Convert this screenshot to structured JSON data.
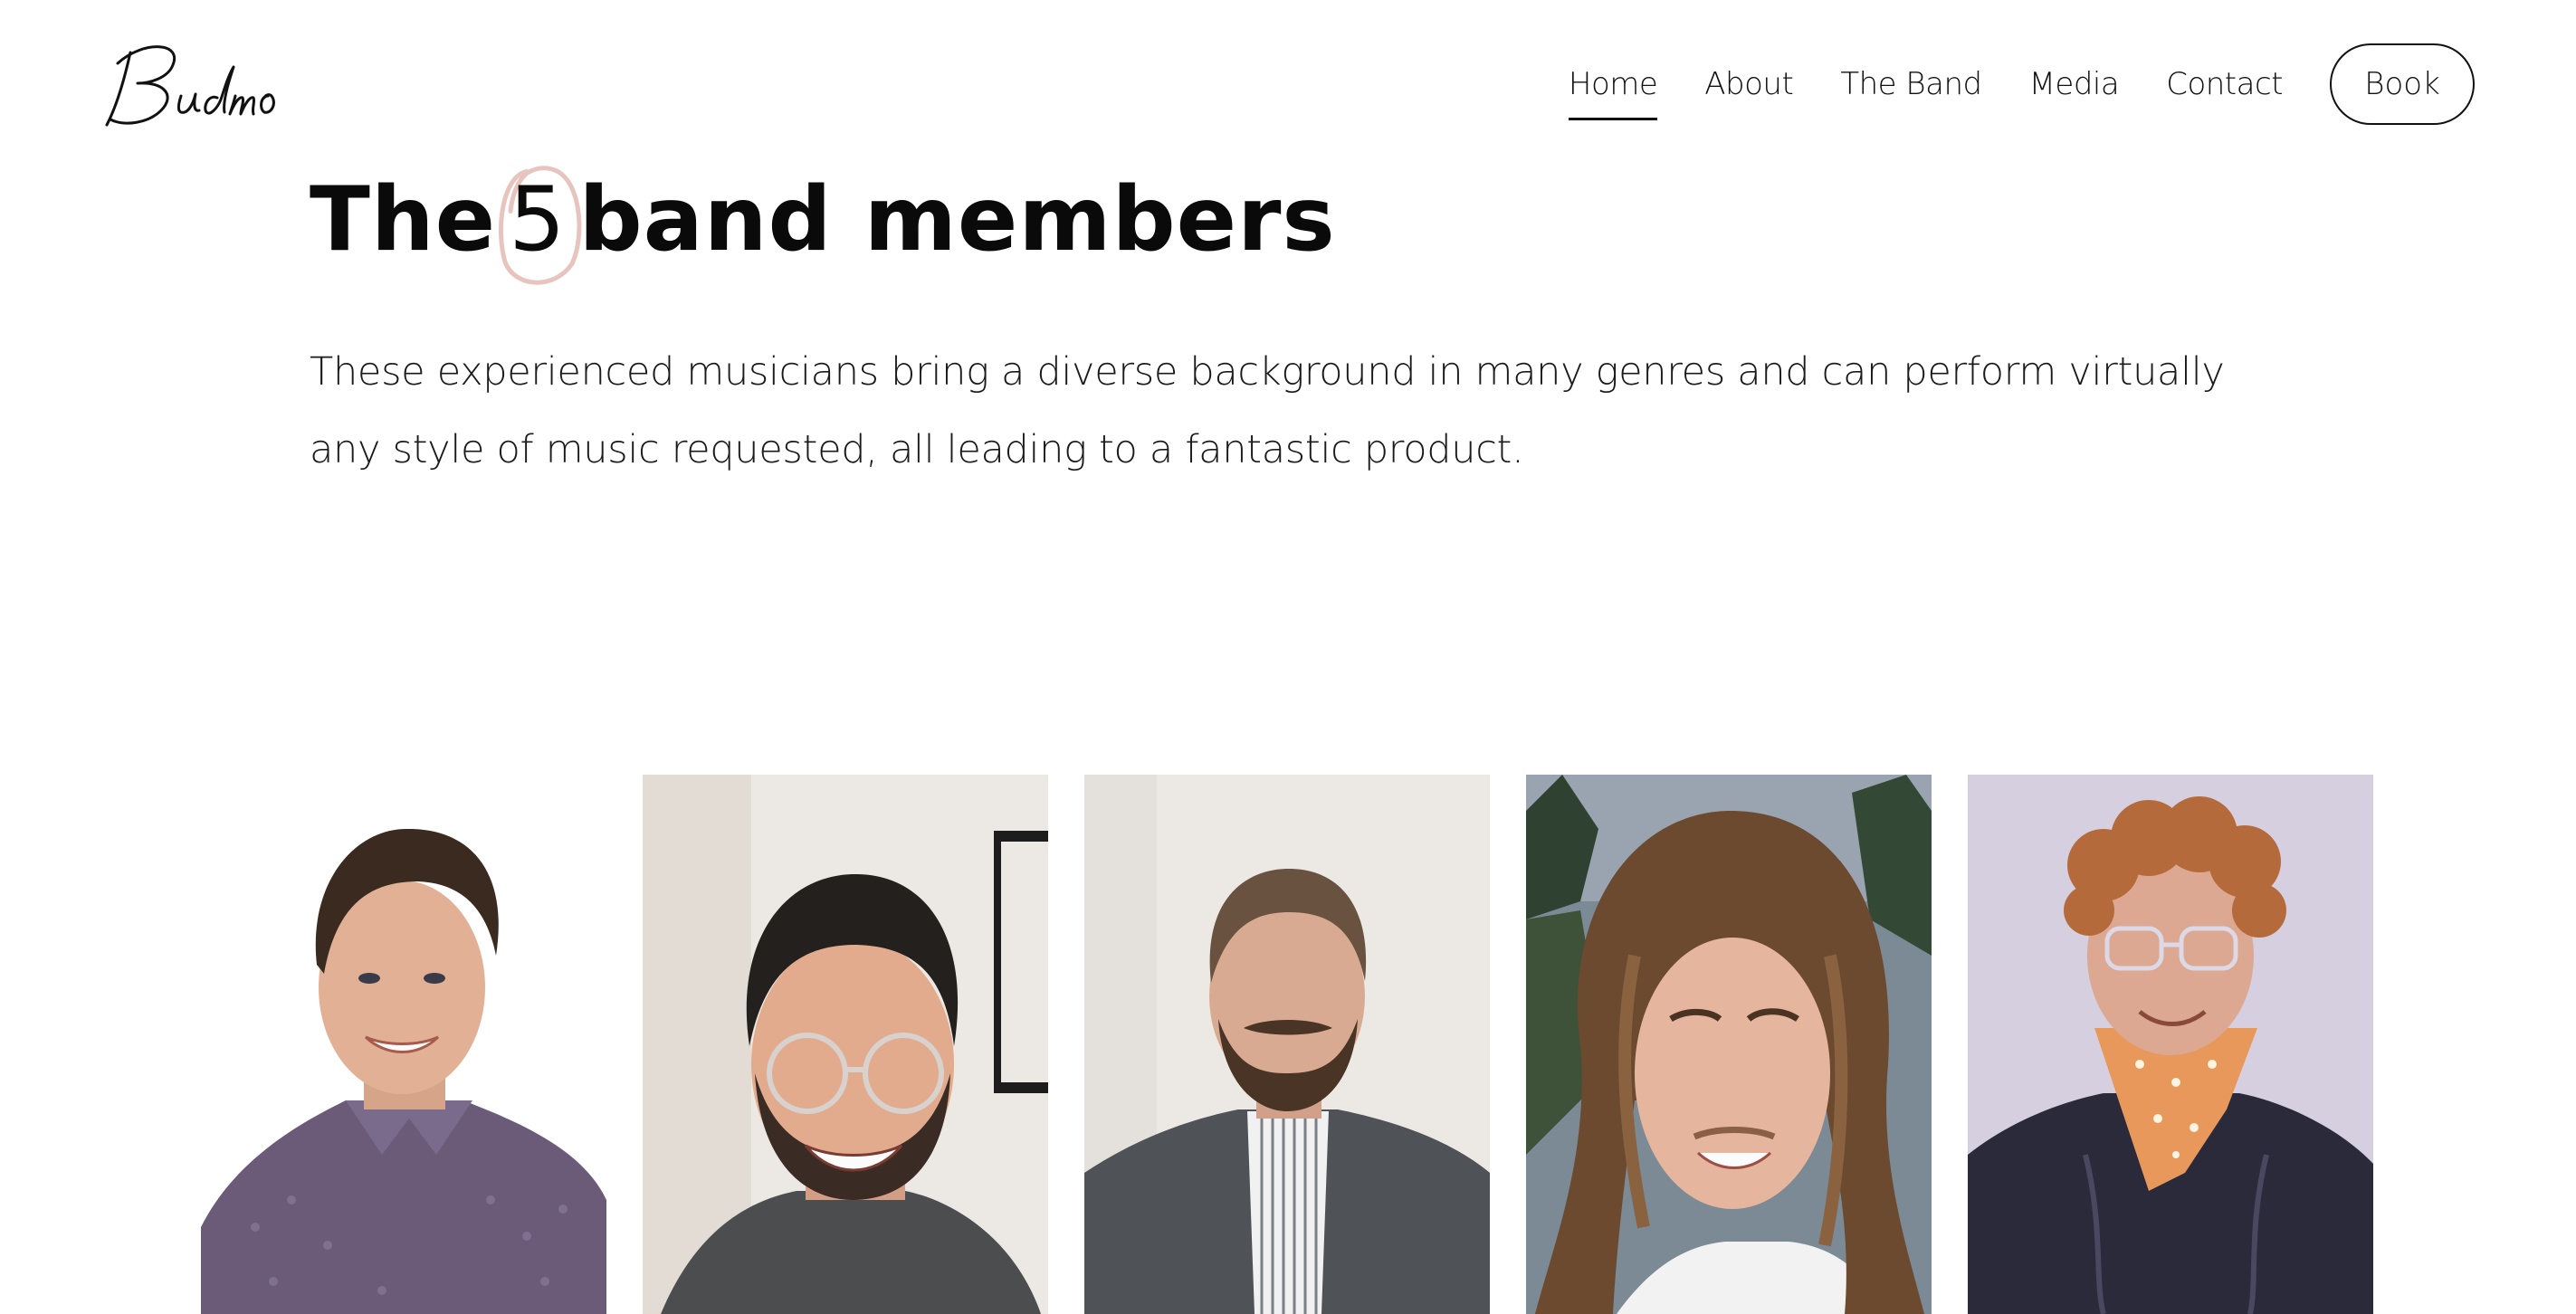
{
  "header": {
    "logo_text": "Budmo",
    "nav": [
      {
        "label": "Home",
        "active": true
      },
      {
        "label": "About",
        "active": false
      },
      {
        "label": "The Band",
        "active": false
      },
      {
        "label": "Media",
        "active": false
      },
      {
        "label": "Contact",
        "active": false
      }
    ],
    "book_label": "Book"
  },
  "hero": {
    "title_prefix": "The",
    "title_number": "5",
    "title_suffix": "band members",
    "description": "These experienced musicians bring a diverse background in many genres and can perform virtually any style of music requested, all leading to a fantastic product."
  },
  "colors": {
    "accent_ring": "#e8c4bf",
    "text": "#111111",
    "background": "#ffffff"
  },
  "members": [
    {
      "photo": "member-1-photo"
    },
    {
      "photo": "member-2-photo"
    },
    {
      "photo": "member-3-photo"
    },
    {
      "photo": "member-4-photo"
    },
    {
      "photo": "member-5-photo"
    }
  ]
}
